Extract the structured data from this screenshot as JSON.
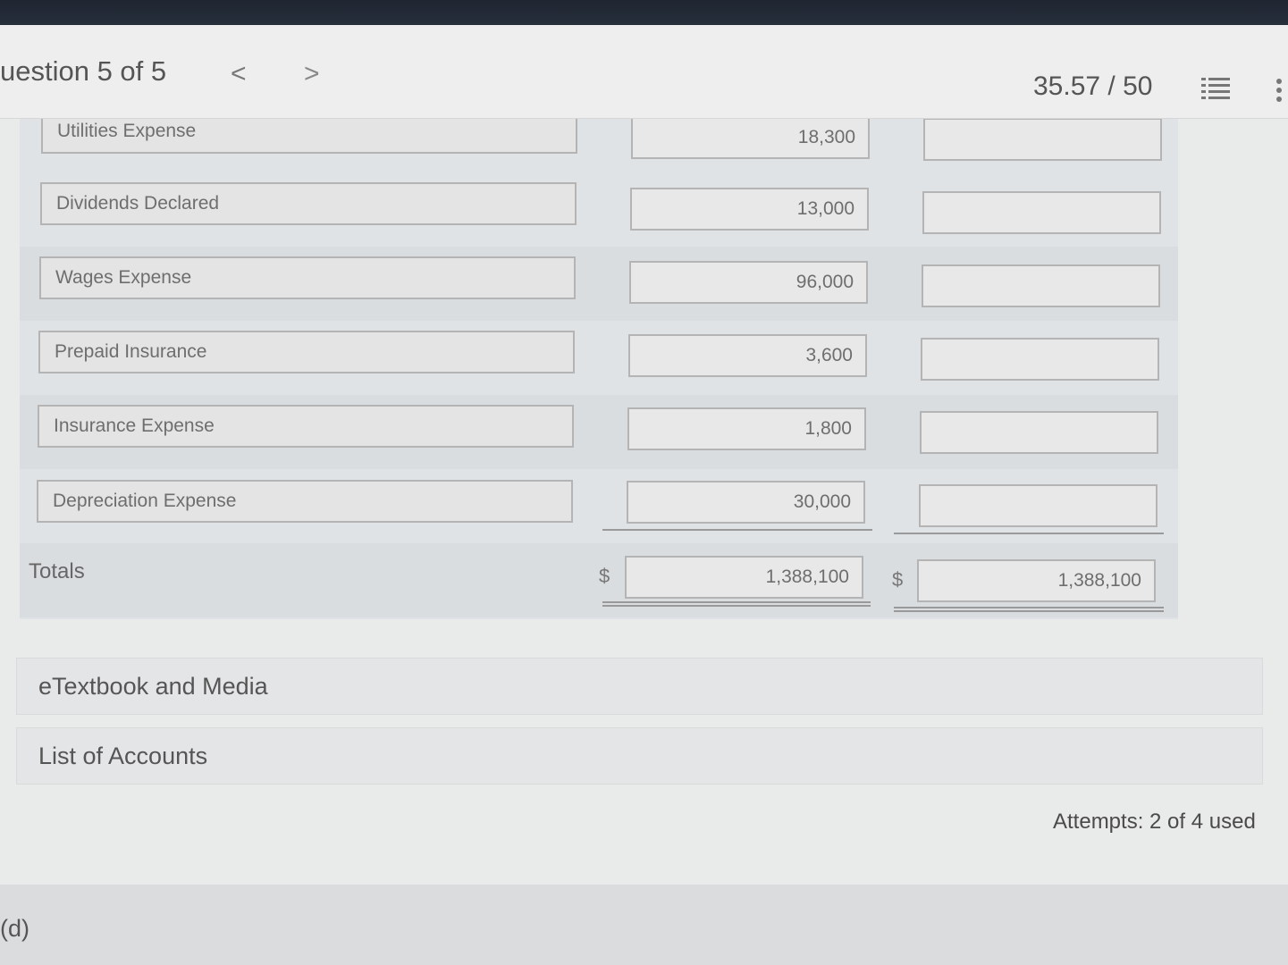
{
  "header": {
    "question_title": "uestion 5 of 5",
    "prev_glyph": "<",
    "next_glyph": ">",
    "score": "35.57 / 50"
  },
  "rows": [
    {
      "account": "Utilities Expense",
      "debit": "18,300",
      "credit": ""
    },
    {
      "account": "Dividends Declared",
      "debit": "13,000",
      "credit": ""
    },
    {
      "account": "Wages Expense",
      "debit": "96,000",
      "credit": ""
    },
    {
      "account": "Prepaid Insurance",
      "debit": "3,600",
      "credit": ""
    },
    {
      "account": "Insurance Expense",
      "debit": "1,800",
      "credit": ""
    },
    {
      "account": "Depreciation Expense",
      "debit": "30,000",
      "credit": ""
    }
  ],
  "totals": {
    "label": "Totals",
    "debit_symbol": "$",
    "debit": "1,388,100",
    "credit_symbol": "$",
    "credit": "1,388,100"
  },
  "panels": {
    "etextbook": "eTextbook and Media",
    "accounts": "List of Accounts"
  },
  "attempts": "Attempts: 2 of 4 used",
  "part_label": "(d)"
}
